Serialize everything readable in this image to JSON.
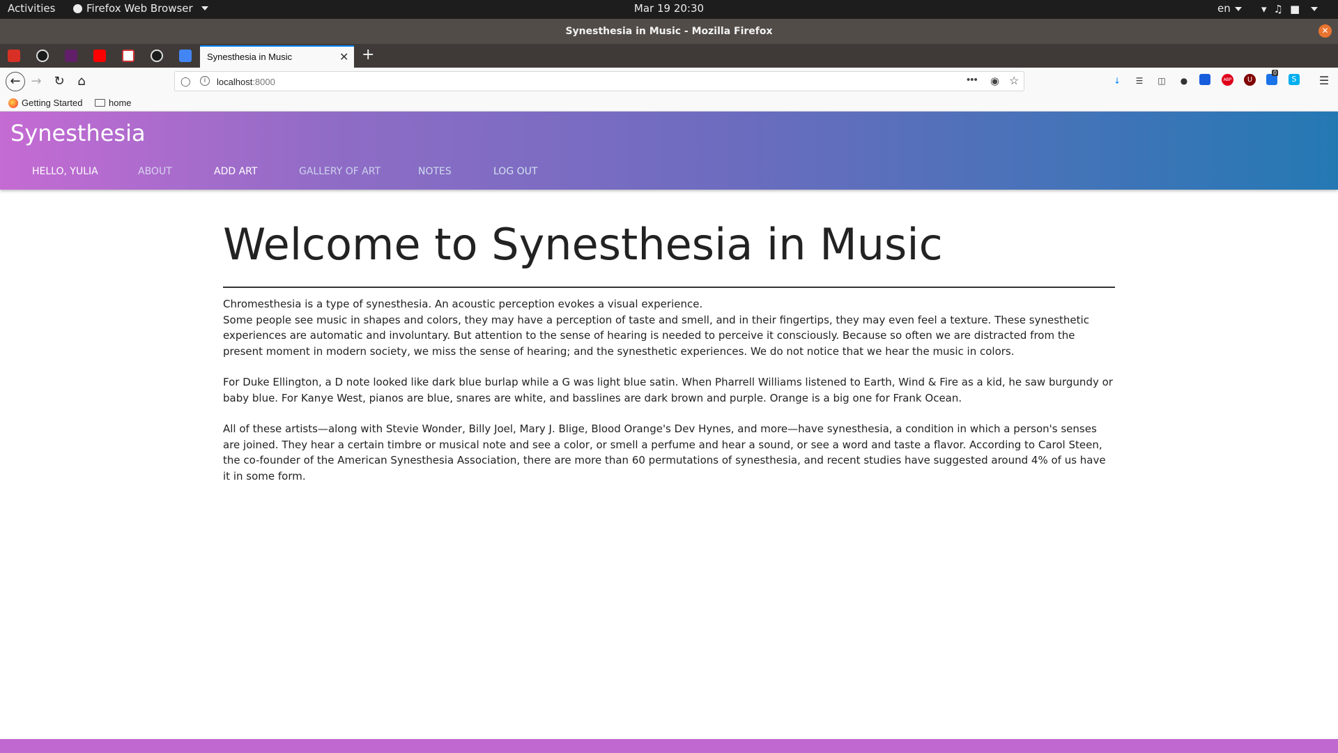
{
  "system": {
    "activities": "Activities",
    "app_menu": "Firefox Web Browser",
    "clock": "Mar 19  20:30",
    "lang": "en"
  },
  "window": {
    "title": "Synesthesia in Music - Mozilla Firefox"
  },
  "tabs": {
    "active_label": "Synesthesia in Music",
    "pinned_icons": [
      "gmail-icon",
      "github-icon",
      "slack-icon",
      "youtube-icon",
      "bookmark-app-icon",
      "github-icon",
      "docs-icon"
    ]
  },
  "navbar": {
    "url_host": "localhost",
    "url_port": ":8000"
  },
  "bookmarks": [
    {
      "label": "Getting Started"
    },
    {
      "label": "home"
    }
  ],
  "toolbar": {
    "badge_count": "0"
  },
  "site": {
    "brand": "Synesthesia",
    "nav": {
      "hello": "HELLO, YULIA",
      "about": "ABOUT",
      "add_art": "ADD ART",
      "gallery": "GALLERY OF ART",
      "notes": "NOTES",
      "logout": "LOG OUT"
    },
    "heading": "Welcome to Synesthesia in Music",
    "paragraphs": [
      "Chromesthesia is a type of synesthesia. An acoustic perception evokes a visual experience.",
      "Some people see music in shapes and colors, they may have a perception of taste and smell, and in their fingertips, they may even feel a texture. These synesthetic experiences are automatic and involuntary. But attention to the sense of hearing is needed to perceive it consciously. Because so often we are distracted from the present moment in modern society, we miss the sense of hearing; and the synesthetic experiences. We do not notice that we hear the music in colors.",
      "For Duke Ellington, a D note looked like dark blue burlap while a G was light blue satin. When Pharrell Williams listened to Earth, Wind & Fire as a kid, he saw burgundy or baby blue. For Kanye West, pianos are blue, snares are white, and basslines are dark brown and purple. Orange is a big one for Frank Ocean.",
      "All of these artists—along with Stevie Wonder, Billy Joel, Mary J. Blige, Blood Orange's Dev Hynes, and more—have synesthesia, a condition in which a person's senses are joined. They hear a certain timbre or musical note and see a color, or smell a perfume and hear a sound, or see a word and taste a flavor. According to Carol Steen, the co-founder of the American Synesthesia Association, there are more than 60 permutations of synesthesia, and recent studies have suggested around 4% of us have it in some form."
    ]
  },
  "colors": {
    "header_gradient_start": "#c56bd3",
    "header_gradient_end": "#2479b3",
    "footer": "#c167d0",
    "tab_accent": "#0a84ff"
  }
}
